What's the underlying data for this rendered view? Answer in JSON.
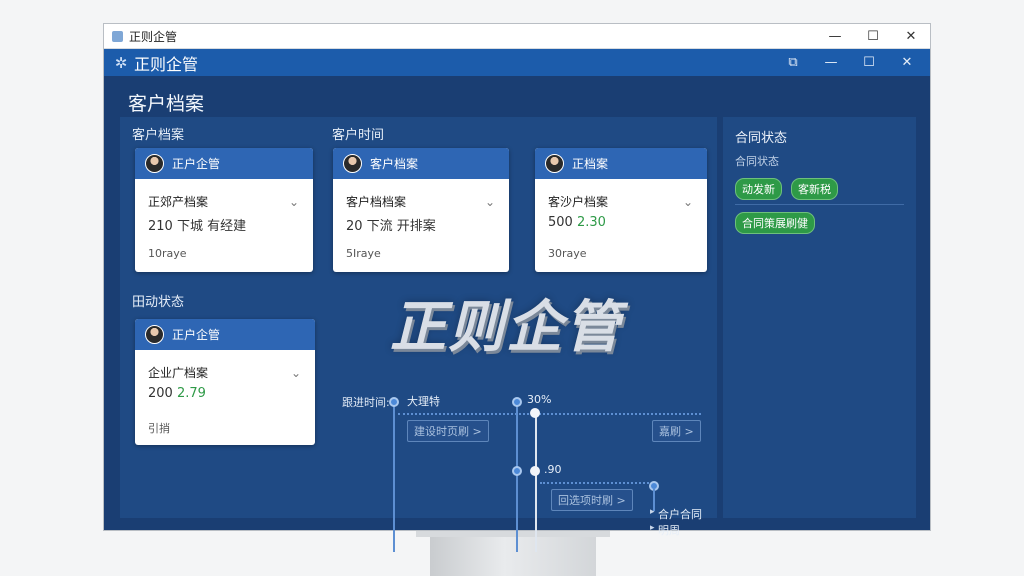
{
  "os_window": {
    "title": "正则企管",
    "controls": [
      "—",
      "☐",
      "✕"
    ]
  },
  "app": {
    "title": "正则企管",
    "logo_icon": "✲",
    "controls": [
      "⧉",
      "—",
      "☐",
      "✕"
    ],
    "page_title": "客户档案",
    "watermark": "正则企管"
  },
  "sections": {
    "customer_files": "客户档案",
    "customer_time": "客户时间",
    "activity_status": "田动状态"
  },
  "cards": [
    {
      "name": "正户企管",
      "line1": "正郊产档案",
      "line2_prefix": "210 下城 有经建",
      "line2_highlight": "",
      "footer": "10raye"
    },
    {
      "name": "客户档案",
      "line1": "客户档档案",
      "line2_prefix": "20 下流 开排案",
      "line2_highlight": "",
      "footer": "5Iraye"
    },
    {
      "name": "正档案",
      "line1": "客沙户档案",
      "line2_prefix": "500 ",
      "line2_highlight": "2.30",
      "footer": "30raye"
    },
    {
      "name": "正户企管",
      "line1": "企业广档案",
      "line2_prefix": "200 ",
      "line2_highlight": "2.79",
      "footer": "引捎"
    }
  ],
  "timeline": {
    "label": "跟进时间:",
    "point1": "大理特",
    "point2": "30%",
    "point3": ".90",
    "btn1": "建设时页刷 >",
    "btn2": "嘉刷 >",
    "btn3": "回选项时刷 >",
    "item1": "合户合同",
    "item2": "明周"
  },
  "side": {
    "title": "合同状态",
    "subtitle": "合同状态",
    "tags": [
      "动发新",
      "客新税",
      "合同策展刷健"
    ],
    "tag_color": "#2e9a47"
  }
}
